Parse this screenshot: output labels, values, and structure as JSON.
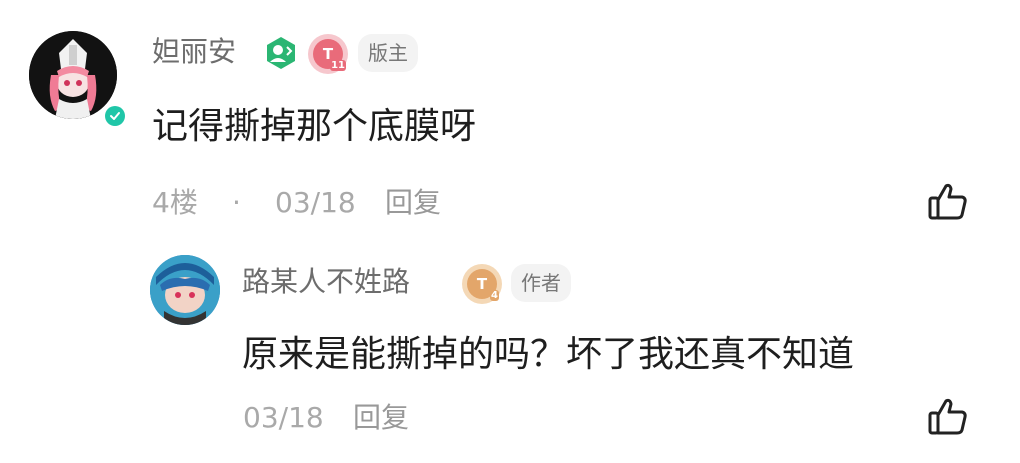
{
  "comment": {
    "username": "妲丽安",
    "role_badge": "版主",
    "level_badge_text": "11",
    "text": "记得撕掉那个底膜呀",
    "floor": "4楼",
    "separator": "·",
    "date": "03/18",
    "reply_label": "回复"
  },
  "sub_comment": {
    "username": "路某人不姓路",
    "role_badge": "作者",
    "level_badge_text": "4",
    "text": "原来是能撕掉的吗？坏了我还真不知道",
    "date": "03/18",
    "reply_label": "回复"
  },
  "colors": {
    "verify_badge": "#20c6a8",
    "green_badge": "#2bb673",
    "pink_badge": "#e96b7a",
    "orange_badge": "#e3a66a",
    "meta_text": "#a9a9a9"
  },
  "icons": {
    "like": "thumbs-up-icon",
    "verify": "check-badge-icon",
    "moderator": "moderator-icon"
  }
}
